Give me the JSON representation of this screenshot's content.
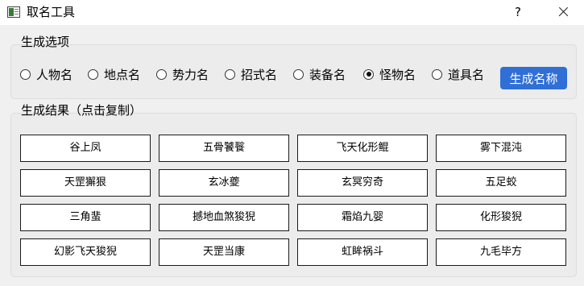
{
  "window": {
    "title": "取名工具",
    "help": "?",
    "close_icon": "close-icon"
  },
  "options_group": {
    "title": "生成选项",
    "radios": [
      {
        "label": "人物名",
        "checked": false
      },
      {
        "label": "地点名",
        "checked": false
      },
      {
        "label": "势力名",
        "checked": false
      },
      {
        "label": "招式名",
        "checked": false
      },
      {
        "label": "装备名",
        "checked": false
      },
      {
        "label": "怪物名",
        "checked": true
      },
      {
        "label": "道具名",
        "checked": false
      }
    ],
    "generate_label": "生成名称",
    "accent": "#2f6fd6"
  },
  "results_group": {
    "title": "生成结果（点击复制）",
    "rows": [
      [
        "谷上凤",
        "五骨饕餮",
        "飞天化形鲲",
        "雾下混沌"
      ],
      [
        "天罡獬狠",
        "玄冰夔",
        "玄冥穷奇",
        "五足蛟"
      ],
      [
        "三角蜚",
        "撼地血煞狻猊",
        "霜焰九婴",
        "化形狻猊"
      ],
      [
        "幻影飞天狻猊",
        "天罡当康",
        "虹眸祸斗",
        "九毛毕方"
      ]
    ]
  }
}
